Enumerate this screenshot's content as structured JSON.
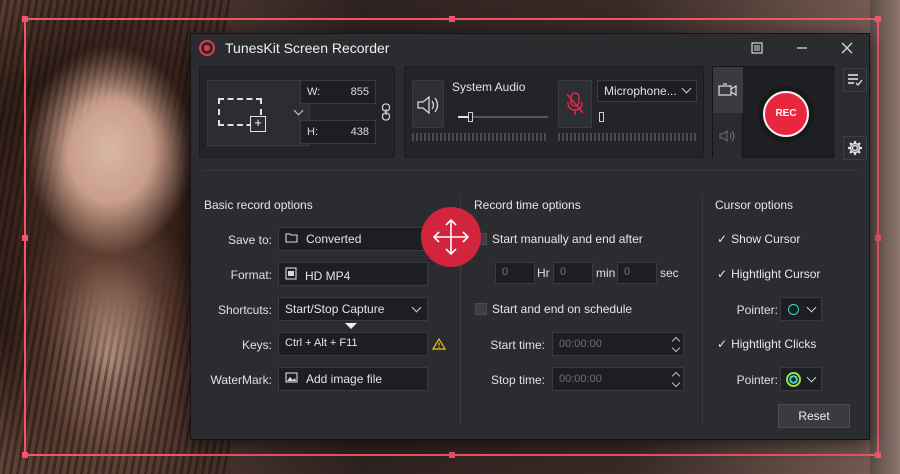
{
  "window": {
    "title": "TunesKit Screen Recorder",
    "menu_icon": "list-icon",
    "minimize_icon": "minimize-icon",
    "close_icon": "close-icon"
  },
  "region": {
    "width_label": "W:",
    "width_value": "855",
    "height_label": "H:",
    "height_value": "438"
  },
  "audio": {
    "system_label": "System Audio",
    "system_volume": 0.08,
    "microphone_selected": "Microphone...",
    "microphone_volume": 0.0
  },
  "record": {
    "rec_label": "REC"
  },
  "basic": {
    "title": "Basic record options",
    "save_to_label": "Save to:",
    "save_to_value": "Converted",
    "format_label": "Format:",
    "format_value": "HD MP4",
    "shortcuts_label": "Shortcuts:",
    "shortcuts_value": "Start/Stop Capture",
    "keys_label": "Keys:",
    "keys_value": "Ctrl + Alt + F11",
    "watermark_label": "WaterMark:",
    "watermark_value": "Add image file"
  },
  "time": {
    "title": "Record time options",
    "manual_label": "Start manually and end after",
    "hr_placeholder": "0",
    "hr_unit": "Hr",
    "min_placeholder": "0",
    "min_unit": "min",
    "sec_placeholder": "0",
    "sec_unit": "sec",
    "schedule_label": "Start and end on schedule",
    "start_label": "Start time:",
    "start_value": "00:00:00",
    "stop_label": "Stop time:",
    "stop_value": "00:00:00"
  },
  "cursor": {
    "title": "Cursor options",
    "show_label": "Show Cursor",
    "highlight_cursor_label": "Hightlight Cursor",
    "pointer_label": "Pointer:",
    "highlight_clicks_label": "Hightlight Clicks",
    "pointer2_label": "Pointer:",
    "reset_label": "Reset",
    "highlight_color": "#3ad6c8",
    "click_color": "#9be24a"
  },
  "colors": {
    "accent": "#e8273f",
    "frame": "#f0566a",
    "window_bg": "#2b2c30"
  }
}
